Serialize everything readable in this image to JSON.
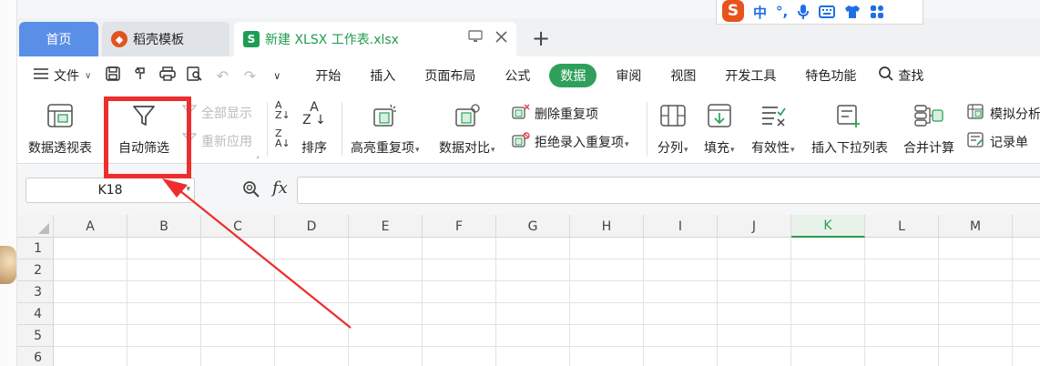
{
  "ime": {
    "logo": "S",
    "items": [
      "中",
      "°,",
      "🎤",
      "⌨",
      "👕",
      "▦"
    ]
  },
  "tabs": {
    "home": "首页",
    "template": "稻壳模板",
    "doc": "新建 XLSX 工作表.xlsx",
    "new_tab": "+"
  },
  "menubar": {
    "file": "文件",
    "menus": [
      "开始",
      "插入",
      "页面布局",
      "公式",
      "数据",
      "审阅",
      "视图",
      "开发工具",
      "特色功能"
    ],
    "active_menu": "数据",
    "search": "查找"
  },
  "ribbon": {
    "pivot": "数据透视表",
    "autofilter": "自动筛选",
    "show_all": "全部显示",
    "reapply": "重新应用",
    "sort": "排序",
    "highlight_dup": "高亮重复项",
    "compare": "数据对比",
    "remove_dup": "删除重复项",
    "reject_dup": "拒绝录入重复项",
    "split": "分列",
    "fill": "填充",
    "validity": "有效性",
    "dropdown": "插入下拉列表",
    "consolidate": "合并计算",
    "simulate": "模拟分析",
    "record": "记录单"
  },
  "formula_bar": {
    "cell_ref": "K18",
    "fx": "fx",
    "value": ""
  },
  "grid": {
    "columns": [
      "A",
      "B",
      "C",
      "D",
      "E",
      "F",
      "G",
      "H",
      "I",
      "J",
      "K",
      "L",
      "M"
    ],
    "selected_column": "K",
    "rows": [
      "1",
      "2",
      "3",
      "4",
      "5",
      "6"
    ]
  },
  "colors": {
    "accent": "#2fa05b",
    "annotation": "#ee2d2d",
    "home_tab": "#5a8fe8"
  }
}
